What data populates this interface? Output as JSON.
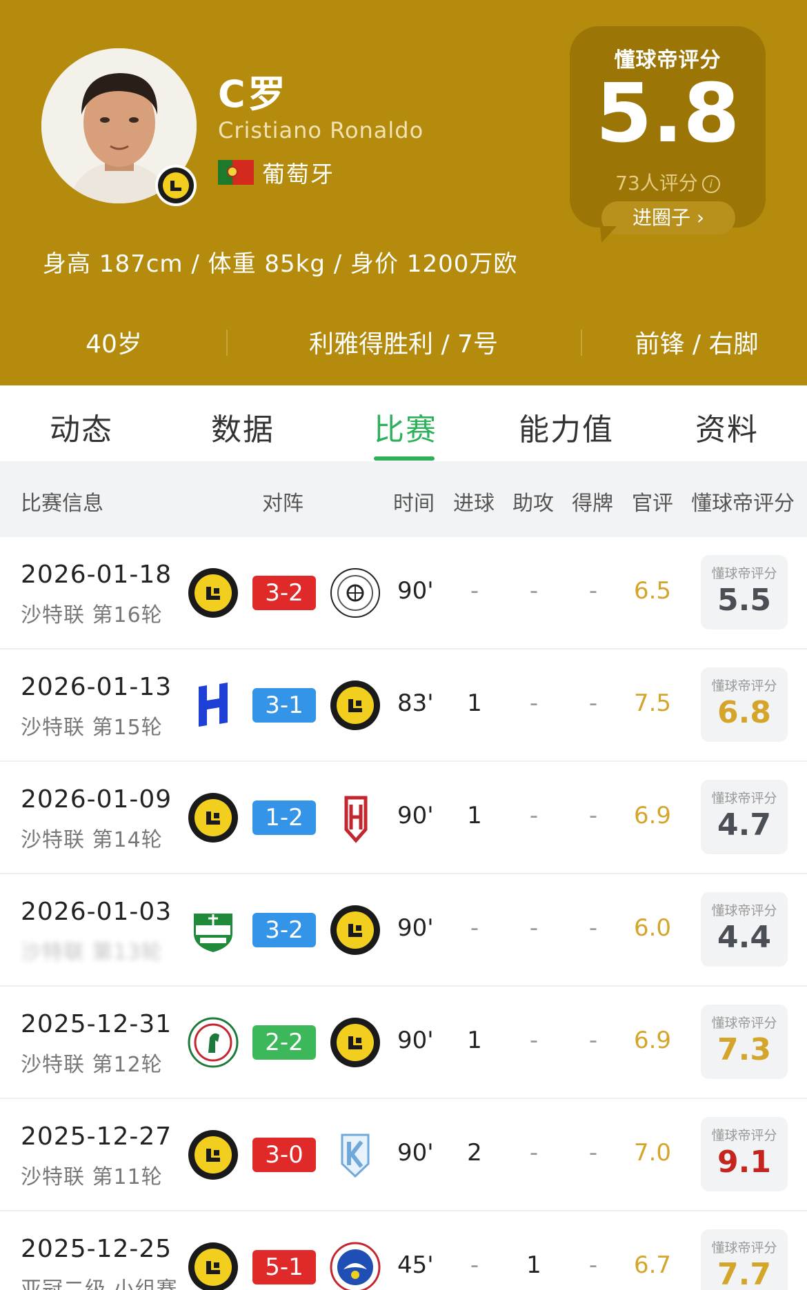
{
  "player": {
    "name_cn": "C罗",
    "name_en": "Cristiano Ronaldo",
    "country": "葡萄牙",
    "body_info": "身高 187cm / 体重 85kg / 身价 1200万欧",
    "age": "40岁",
    "club_number": "利雅得胜利 / 7号",
    "position_foot": "前锋 / 右脚"
  },
  "rating": {
    "label": "懂球帝评分",
    "score": "5.8",
    "count": "73人评分",
    "button": "进圈子 ›"
  },
  "tabs": [
    "动态",
    "数据",
    "比赛",
    "能力值",
    "资料"
  ],
  "active_tab": "比赛",
  "table_headers": {
    "info": "比赛信息",
    "vs": "对阵",
    "time": "时间",
    "goals": "进球",
    "assists": "助攻",
    "cards": "得牌",
    "official": "官评",
    "user": "懂球帝评分"
  },
  "user_rating_label": "懂球帝评分",
  "matches": [
    {
      "date": "2026-01-18",
      "competition": "沙特联 第16轮",
      "home": "al-nassr-logo",
      "away": "al-shabab-logo",
      "score": "3-2",
      "score_color": "#e02a2a",
      "time": "90'",
      "goals": "-",
      "assists": "-",
      "cards": "-",
      "official": "6.5",
      "user": "5.5",
      "user_color": "grey"
    },
    {
      "date": "2026-01-13",
      "competition": "沙特联 第15轮",
      "home": "al-hilal-logo",
      "away": "al-nassr-logo",
      "score": "3-1",
      "score_color": "#3394e8",
      "time": "83'",
      "goals": "1",
      "assists": "-",
      "cards": "-",
      "official": "7.5",
      "user": "6.8",
      "user_color": "gold"
    },
    {
      "date": "2026-01-09",
      "competition": "沙特联 第14轮",
      "home": "al-nassr-logo",
      "away": "al-qadsiah-logo",
      "score": "1-2",
      "score_color": "#3394e8",
      "time": "90'",
      "goals": "1",
      "assists": "-",
      "cards": "-",
      "official": "6.9",
      "user": "4.7",
      "user_color": "grey"
    },
    {
      "date": "2026-01-03",
      "competition": "沙特联 第13轮",
      "home": "al-ahli-logo",
      "away": "al-nassr-logo",
      "score": "3-2",
      "score_color": "#3394e8",
      "time": "90'",
      "goals": "-",
      "assists": "-",
      "cards": "-",
      "official": "6.0",
      "user": "4.4",
      "user_color": "grey",
      "blurred": true
    },
    {
      "date": "2025-12-31",
      "competition": "沙特联 第12轮",
      "home": "al-ettifaq-logo",
      "away": "al-nassr-logo",
      "score": "2-2",
      "score_color": "#3cb85a",
      "time": "90'",
      "goals": "1",
      "assists": "-",
      "cards": "-",
      "official": "6.9",
      "user": "7.3",
      "user_color": "gold"
    },
    {
      "date": "2025-12-27",
      "competition": "沙特联 第11轮",
      "home": "al-nassr-logo",
      "away": "al-akhdoud-logo",
      "score": "3-0",
      "score_color": "#e02a2a",
      "time": "90'",
      "goals": "2",
      "assists": "-",
      "cards": "-",
      "official": "7.0",
      "user": "9.1",
      "user_color": "red"
    },
    {
      "date": "2025-12-25",
      "competition": "亚冠二级 小组赛",
      "home": "al-nassr-logo",
      "away": "al-zawraa-logo",
      "score": "5-1",
      "score_color": "#e02a2a",
      "time": "45'",
      "goals": "-",
      "assists": "1",
      "cards": "-",
      "official": "6.7",
      "user": "7.7",
      "user_color": "gold"
    }
  ]
}
